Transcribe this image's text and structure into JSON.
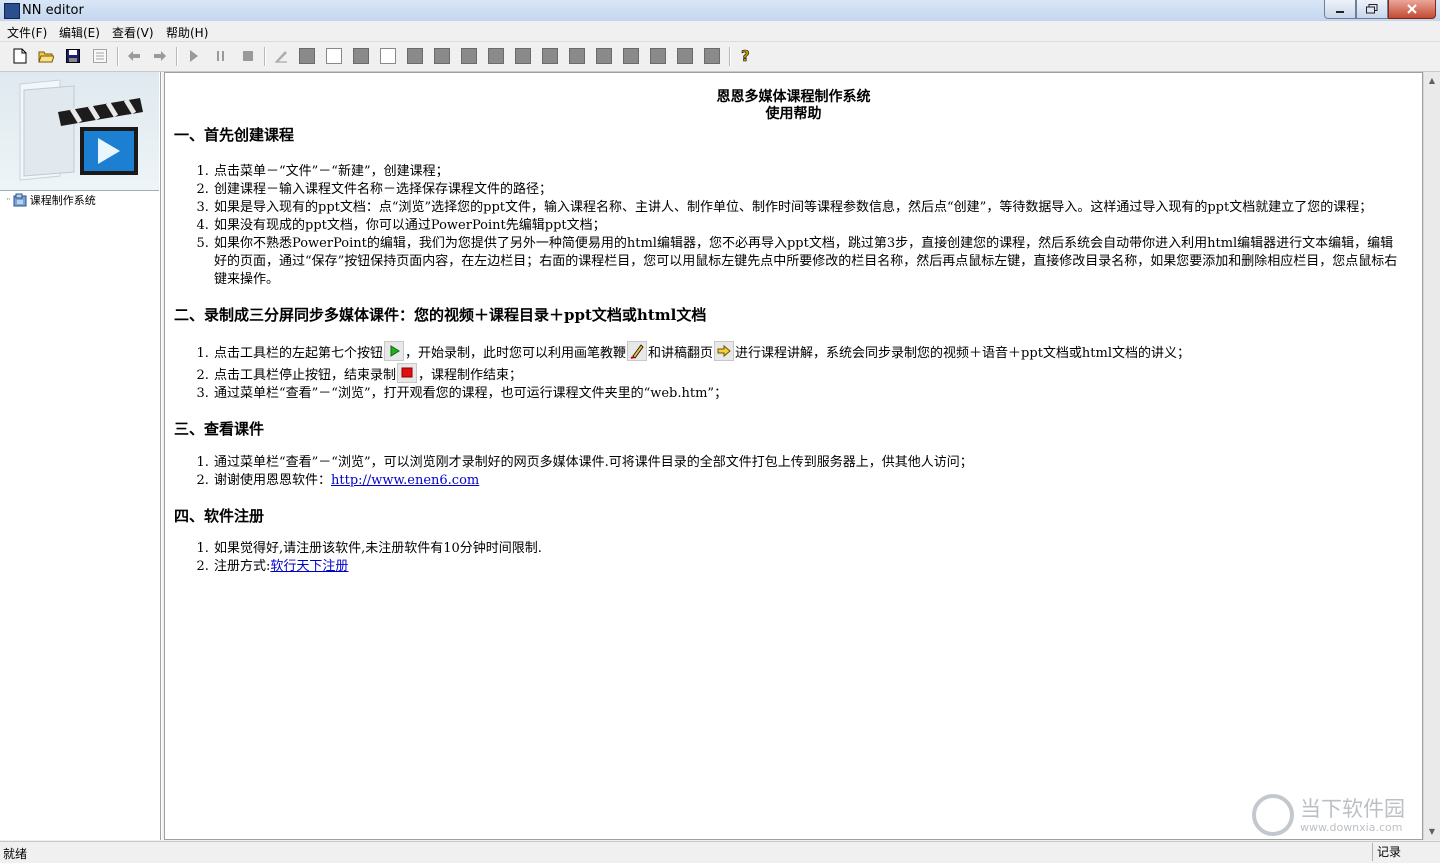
{
  "window": {
    "title": "NN editor"
  },
  "menu": [
    "文件(F)",
    "编辑(E)",
    "查看(V)",
    "帮助(H)"
  ],
  "sidebar": {
    "tree_item": "课程制作系统"
  },
  "doc": {
    "title_line1": "恩恩多媒体课程制作系统",
    "title_line2": "使用帮助",
    "sec1": {
      "heading": "一、首先创建课程",
      "items": [
        "点击菜单－“文件”－“新建”，创建课程；",
        "创建课程－输入课程文件名称－选择保存课程文件的路径；",
        "如果是导入现有的ppt文档：点“浏览”选择您的ppt文件，输入课程名称、主讲人、制作单位、制作时间等课程参数信息，然后点“创建”，等待数据导入。这样通过导入现有的ppt文档就建立了您的课程；",
        "如果没有现成的ppt文档，你可以通过PowerPoint先编辑ppt文档；",
        "如果你不熟悉PowerPoint的编辑，我们为您提供了另外一种简便易用的html编辑器，您不必再导入ppt文档，跳过第3步，直接创建您的课程，然后系统会自动带你进入利用html编辑器进行文本编辑，编辑好的页面，通过“保存”按钮保持页面内容，在左边栏目；右面的课程栏目，您可以用鼠标左键先点中所要修改的栏目名称，然后再点鼠标左键，直接修改目录名称，如果您要添加和删除相应栏目，您点鼠标右键来操作。"
      ]
    },
    "sec2": {
      "heading": "二、录制成三分屏同步多媒体课件：您的视频＋课程目录＋ppt文档或html文档",
      "item1_a": "点击工具栏的左起第七个按钮",
      "item1_b": "，开始录制，此时您可以利用画笔教鞭",
      "item1_c": "和讲稿翻页",
      "item1_d": "进行课程讲解，系统会同步录制您的视频＋语音＋ppt文档或html文档的讲义；",
      "item2_a": "点击工具栏停止按钮，结束录制",
      "item2_b": "，课程制作结束；",
      "item3": "通过菜单栏“查看”－“浏览”，打开观看您的课程，也可运行课程文件夹里的“web.htm”；"
    },
    "sec3": {
      "heading": "三、查看课件",
      "item1": "通过菜单栏“查看”－“浏览”，可以浏览刚才录制好的网页多媒体课件.可将课件目录的全部文件打包上传到服务器上，供其他人访问；",
      "item2_a": "谢谢使用恩恩软件：",
      "item2_link": "http://www.enen6.com"
    },
    "sec4": {
      "heading": "四、软件注册",
      "item1": "如果觉得好,请注册该软件,未注册软件有10分钟时间限制.",
      "item2_a": "注册方式:",
      "item2_link": "软行天下注册"
    }
  },
  "status": {
    "left": "就绪",
    "right": "记录"
  },
  "watermark": {
    "main": "当下软件园",
    "sub": "www.downxia.com"
  }
}
